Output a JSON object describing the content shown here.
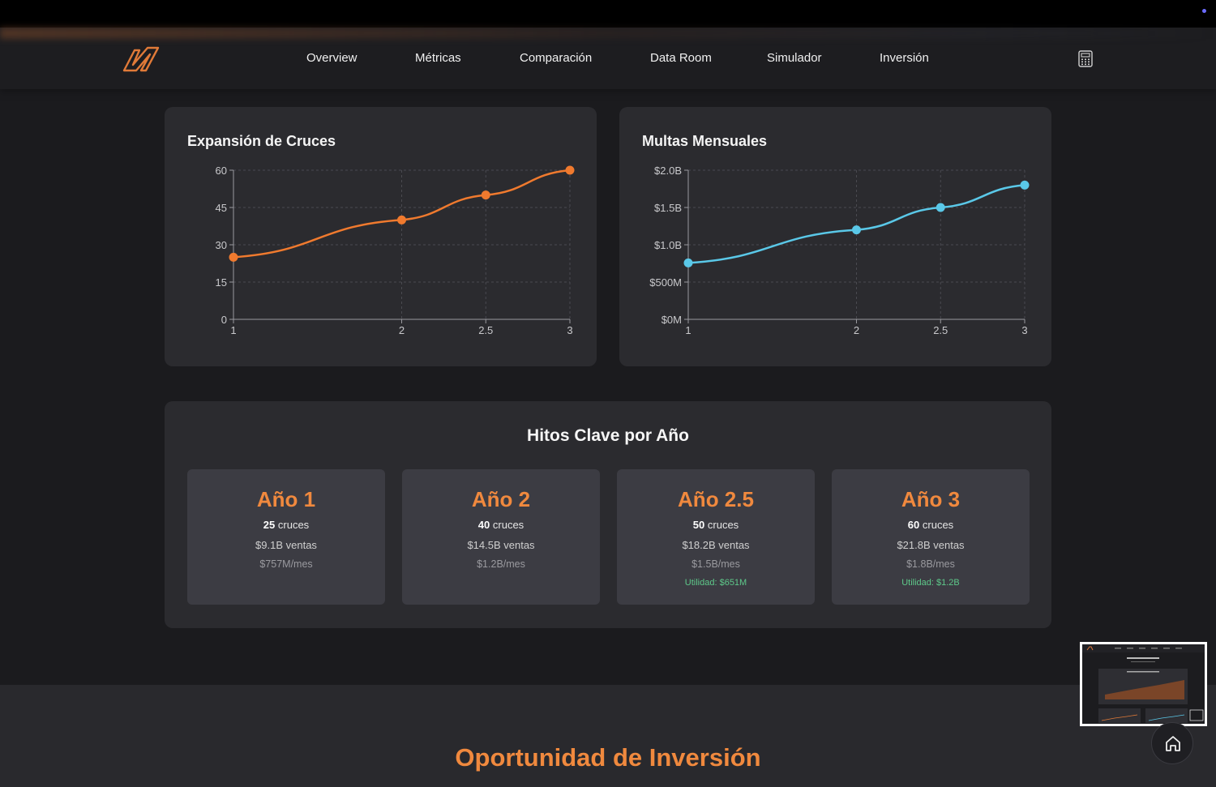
{
  "nav": {
    "logo_icon": "brand-logo",
    "links": [
      "Overview",
      "Métricas",
      "Comparación",
      "Data Room",
      "Simulador",
      "Inversión"
    ],
    "calculator_icon": "calculator-icon"
  },
  "charts": {
    "left_title": "Expansión de Cruces",
    "right_title": "Multas Mensuales"
  },
  "chart_data": [
    {
      "type": "line",
      "title": "Expansión de Cruces",
      "x": [
        "1",
        "2",
        "2.5",
        "3"
      ],
      "series": [
        {
          "values": [
            25,
            40,
            50,
            60
          ]
        }
      ],
      "yticks": [
        "0",
        "15",
        "30",
        "45",
        "60"
      ],
      "ylim": [
        0,
        60
      ],
      "grid": true,
      "color": "#f07a2e"
    },
    {
      "type": "line",
      "title": "Multas Mensuales",
      "x": [
        "1",
        "2",
        "2.5",
        "3"
      ],
      "series": [
        {
          "values": [
            757000000,
            1200000000,
            1500000000,
            1800000000
          ]
        }
      ],
      "yticks": [
        "$0M",
        "$500M",
        "$1.0B",
        "$1.5B",
        "$2.0B"
      ],
      "ylim": [
        0,
        2000000000
      ],
      "grid": true,
      "color": "#5ac8e8"
    }
  ],
  "milestones": {
    "title": "Hitos Clave por Año",
    "items": [
      {
        "year": "Año 1",
        "cruces_num": "25",
        "cruces_label": "cruces",
        "ventas": "$9.1B ventas",
        "mes": "$757M/mes",
        "utilidad": ""
      },
      {
        "year": "Año 2",
        "cruces_num": "40",
        "cruces_label": "cruces",
        "ventas": "$14.5B ventas",
        "mes": "$1.2B/mes",
        "utilidad": ""
      },
      {
        "year": "Año 2.5",
        "cruces_num": "50",
        "cruces_label": "cruces",
        "ventas": "$18.2B ventas",
        "mes": "$1.5B/mes",
        "utilidad": "Utilidad: $651M"
      },
      {
        "year": "Año 3",
        "cruces_num": "60",
        "cruces_label": "cruces",
        "ventas": "$21.8B ventas",
        "mes": "$1.8B/mes",
        "utilidad": "Utilidad: $1.2B"
      }
    ]
  },
  "section": {
    "title": "Oportunidad de Inversión"
  },
  "floating": {
    "home_icon": "home-icon",
    "minimap": "page-minimap"
  },
  "colors": {
    "accent": "#f0893e",
    "line_orange": "#f07a2e",
    "line_blue": "#5ac8e8",
    "success": "#5ec98a"
  }
}
